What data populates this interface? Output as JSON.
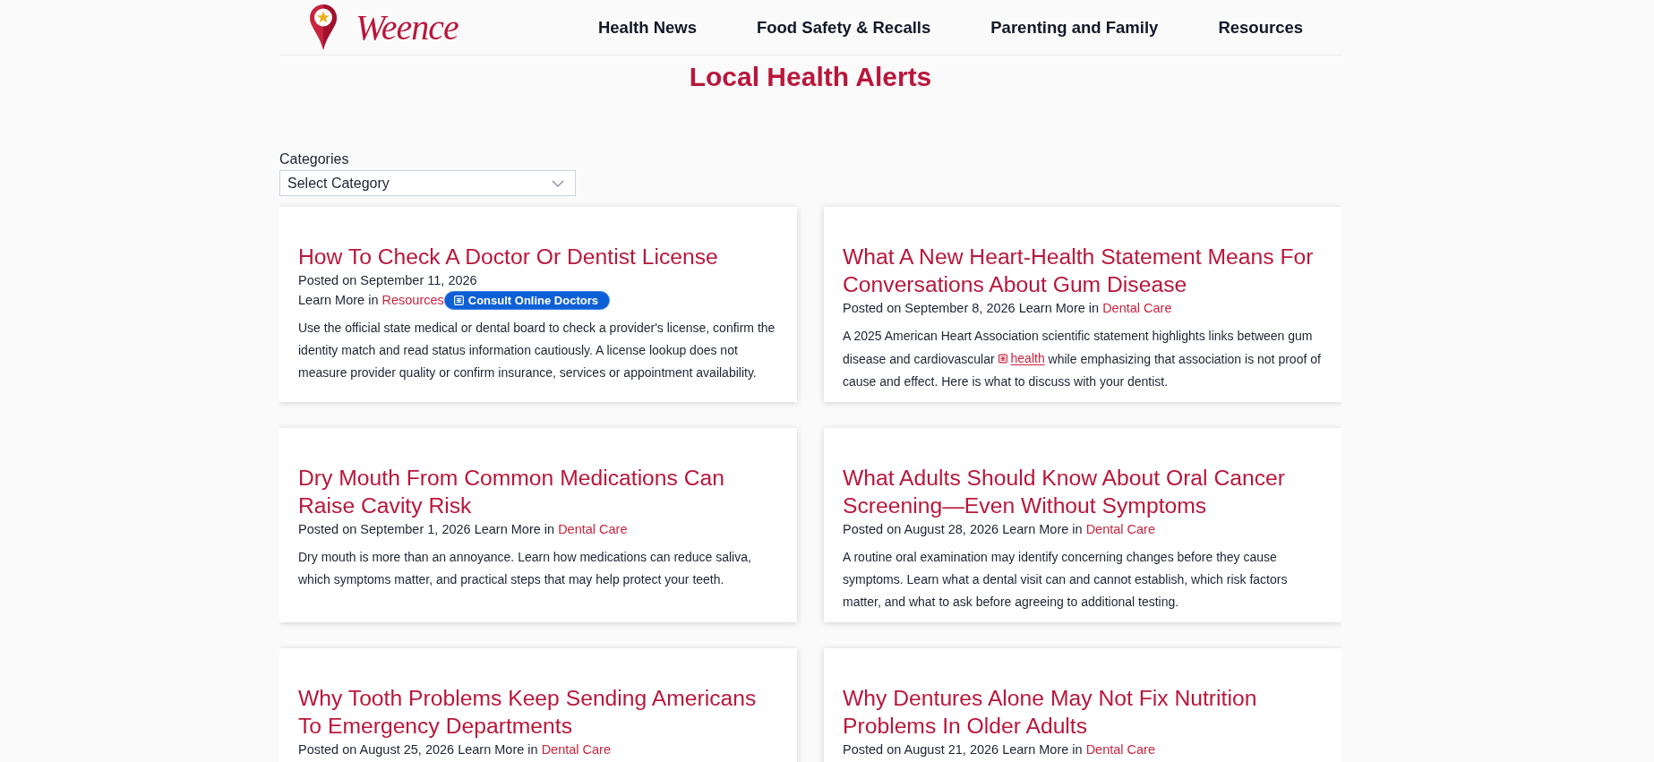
{
  "header": {
    "logo": {
      "text": "Weence"
    },
    "nav": [
      {
        "label": "Health News"
      },
      {
        "label": "Food Safety & Recalls"
      },
      {
        "label": "Parenting and Family"
      },
      {
        "label": "Resources"
      }
    ]
  },
  "page_title": "Local Health Alerts",
  "filter": {
    "label": "Categories",
    "select": {
      "value": "Select Category"
    }
  },
  "posts": [
    {
      "title": "How To Check A Doctor Or Dentist License",
      "date": "Posted on September 11, 2026",
      "category_prefix": "Learn More in",
      "category": "Resources",
      "promo_button": "Consult Online Doctors",
      "excerpt": [
        {
          "kind": "text",
          "text": "Use the official state medical or dental board to check a provider's license, confirm the identity match and read status information cautiously. A license lookup does not measure provider quality or confirm insurance, services or appointment availability."
        }
      ]
    },
    {
      "title": "What A New Heart-Health Statement Means For Conversations About Gum Disease",
      "date": "Posted on September 8, 2026",
      "category_prefix": "Learn More in",
      "category": "Dental Care",
      "excerpt": [
        {
          "kind": "text",
          "text": "A 2025 American Heart Association scientific statement highlights links between gum disease and cardiovascular"
        },
        {
          "kind": "link",
          "text": "health"
        },
        {
          "kind": "text",
          "text": "while emphasizing that association is not proof of cause and effect. Here is what to discuss with your dentist."
        }
      ]
    },
    {
      "title": "Dry Mouth From Common Medications Can Raise Cavity Risk",
      "date": "Posted on September 1, 2026",
      "category_prefix": "Learn More in",
      "category": "Dental Care",
      "excerpt": [
        {
          "kind": "text",
          "text": "Dry mouth is more than an annoyance. Learn how medications can reduce saliva, which symptoms matter, and practical steps that may help protect your teeth."
        }
      ]
    },
    {
      "title": "What Adults Should Know About Oral Cancer Screening—Even Without Symptoms",
      "date": "Posted on August 28, 2026",
      "category_prefix": "Learn More in",
      "category": "Dental Care",
      "excerpt": [
        {
          "kind": "text",
          "text": "A routine oral examination may identify concerning changes before they cause symptoms. Learn what a dental visit can and cannot establish, which risk factors matter, and what to ask before agreeing to additional testing."
        }
      ]
    },
    {
      "title": "Why Tooth Problems Keep Sending Americans To Emergency Departments",
      "date": "Posted on August 25, 2026",
      "category_prefix": "Learn More in",
      "category": "Dental Care"
    },
    {
      "title": "Why Dentures Alone May Not Fix Nutrition Problems In Older Adults",
      "date": "Posted on August 21, 2026",
      "category_prefix": "Learn More in",
      "category": "Dental Care"
    }
  ]
}
